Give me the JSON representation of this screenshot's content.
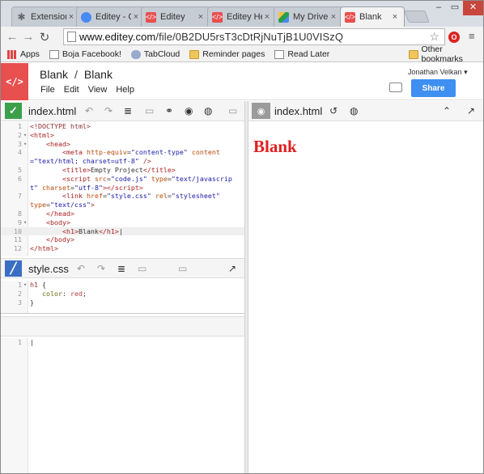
{
  "browser": {
    "tabs": [
      {
        "label": "Extension",
        "icon": "puzzle-icon"
      },
      {
        "label": "Editey - C",
        "icon": "chrome-webstore-icon"
      },
      {
        "label": "Editey",
        "icon": "editey-icon"
      },
      {
        "label": "Editey He",
        "icon": "editey-icon"
      },
      {
        "label": "My Drive",
        "icon": "drive-icon"
      },
      {
        "label": "Blank",
        "icon": "editey-icon"
      }
    ],
    "url_host": "www.editey.com",
    "url_path": "/file/0B2DU5rsT3cDtRjNuTjB1U0VISzQ",
    "bookmarks": [
      {
        "label": "Apps",
        "icon": "apps-grid-icon"
      },
      {
        "label": "Boja Facebook!",
        "icon": "page-icon"
      },
      {
        "label": "TabCloud",
        "icon": "tabcloud-icon"
      },
      {
        "label": "Reminder pages",
        "icon": "folder-icon"
      },
      {
        "label": "Read Later",
        "icon": "page-icon"
      }
    ],
    "other_bookmarks": "Other bookmarks"
  },
  "app": {
    "project": "Blank",
    "separator": "/",
    "file": "Blank",
    "menu": [
      "File",
      "Edit",
      "View",
      "Help"
    ],
    "user": "Jonathan Velkan",
    "share_label": "Share",
    "logo_text": "</>"
  },
  "html_editor": {
    "filename": "index.html",
    "lines": [
      {
        "n": "1",
        "fold": ""
      },
      {
        "n": "2",
        "fold": "▾"
      },
      {
        "n": "3",
        "fold": "▾"
      },
      {
        "n": "4",
        "fold": ""
      },
      {
        "n": "",
        "fold": ""
      },
      {
        "n": "5",
        "fold": ""
      },
      {
        "n": "6",
        "fold": ""
      },
      {
        "n": "",
        "fold": ""
      },
      {
        "n": "7",
        "fold": ""
      },
      {
        "n": "",
        "fold": ""
      },
      {
        "n": "8",
        "fold": ""
      },
      {
        "n": "9",
        "fold": "▾"
      },
      {
        "n": "10",
        "fold": ""
      },
      {
        "n": "11",
        "fold": ""
      },
      {
        "n": "12",
        "fold": ""
      }
    ]
  },
  "css_editor": {
    "filename": "style.css",
    "lines": [
      {
        "n": "1",
        "fold": "▾"
      },
      {
        "n": "2",
        "fold": ""
      },
      {
        "n": "3",
        "fold": ""
      }
    ]
  },
  "js_editor": {
    "lines": [
      {
        "n": "1",
        "fold": ""
      }
    ]
  },
  "preview": {
    "filename": "index.html",
    "heading": "Blank"
  },
  "colors": {
    "logo_bg": "#e84f4f",
    "share_bg": "#3f8ef2",
    "html_icon": "#3ca04a",
    "css_icon": "#3a6fc4",
    "preview_heading": "#e02020"
  }
}
